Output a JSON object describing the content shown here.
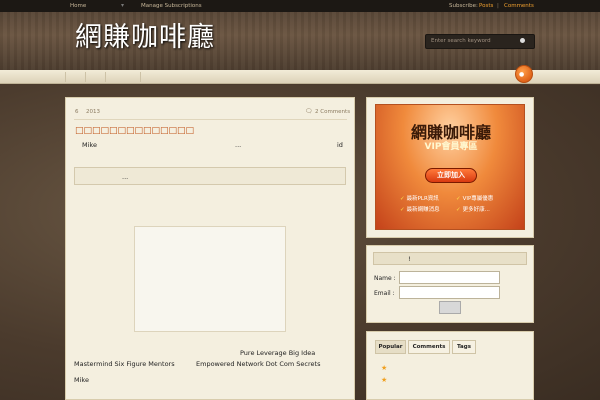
{
  "topbar": {
    "home": "Home",
    "manage_subscriptions": "Manage Subscriptions",
    "subscribe": "Subscribe:",
    "posts": "Posts",
    "separator": "|",
    "comments": "Comments"
  },
  "header": {
    "logo": "網賺咖啡廳",
    "search_placeholder": "Enter search keyword"
  },
  "post": {
    "day": "6",
    "year": "2013",
    "comments_link": "2 Comments",
    "title": "□□□□□□□□□□□□□□",
    "author": "Mike",
    "ellipsis_1": "...",
    "id_text": "id",
    "notice_ellipsis": "...",
    "lines": {
      "line1": "Pure Leverage Big Idea",
      "line2a": "Mastermind Six Figure Mentors",
      "line2b": "Empowered Network Dot Com Secrets",
      "line3": "Mike"
    }
  },
  "vip_banner": {
    "title": "網賺咖啡廳",
    "subtitle": "VIP會員專區",
    "button": "立即加入",
    "features": [
      "最新PLR資訊",
      "VIP專屬優惠",
      "最新網賺消息",
      "更多好康..."
    ]
  },
  "register": {
    "heading": "!",
    "name_label": "Name :",
    "email_label": "Email :"
  },
  "tabs": {
    "popular": "Popular",
    "comments": "Comments",
    "tags": "Tags"
  },
  "colors": {
    "accent_orange": "#f0a030",
    "title_orange": "#c0541a",
    "background_dark": "#4a3a2c",
    "content_bg": "#f4efdf"
  }
}
